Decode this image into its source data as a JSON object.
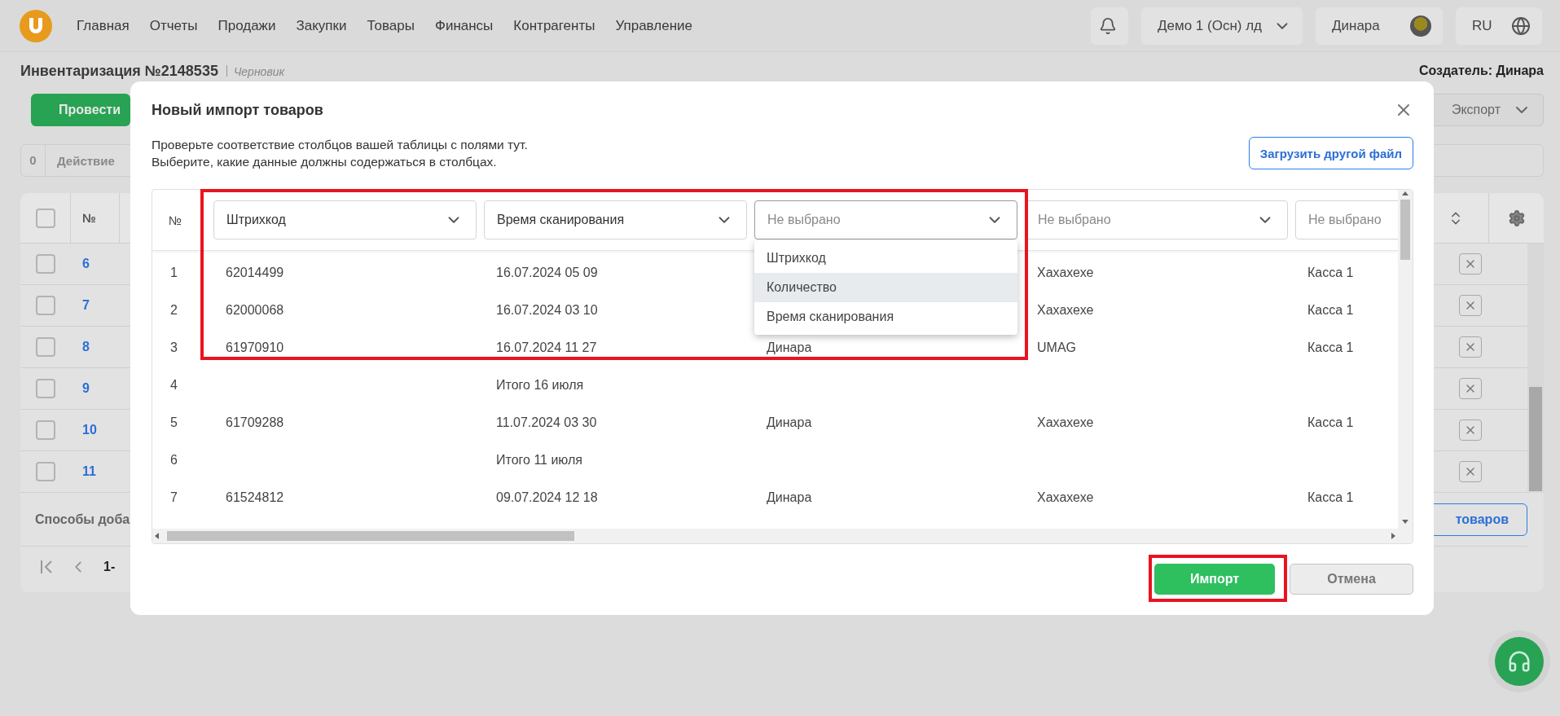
{
  "top_nav": {
    "menu": [
      "Главная",
      "Отчеты",
      "Продажи",
      "Закупки",
      "Товары",
      "Финансы",
      "Контрагенты",
      "Управление"
    ],
    "company": "Демо 1 (Осн) лд",
    "user": "Динара",
    "language": "RU"
  },
  "page": {
    "title": "Инвентаризация №2148535",
    "status": "Черновик",
    "creator": "Создатель: Динара",
    "primary_button": "Провести",
    "export_button": "Экспорт",
    "action_bar": {
      "count": "0",
      "label": "Действие"
    },
    "table": {
      "number_header": "№",
      "all_checked": false,
      "rows": [
        {
          "number": "6",
          "checked": false
        },
        {
          "number": "7",
          "checked": false
        },
        {
          "number": "8",
          "checked": false
        },
        {
          "number": "9",
          "checked": false
        },
        {
          "number": "10",
          "checked": false
        },
        {
          "number": "11",
          "checked": false
        }
      ]
    },
    "add_methods": "Способы доба",
    "add_button": "товаров",
    "pagination": "1-"
  },
  "modal": {
    "title": "Новый импорт товаров",
    "description": [
      "Проверьте соответствие столбцов вашей таблицы с полями тут.",
      "Выберите, какие данные должны содержаться в столбцах."
    ],
    "upload_button": "Загрузить другой файл",
    "number_header": "№",
    "mappings": [
      {
        "value": "Штрихкод",
        "open": false
      },
      {
        "value": "Время сканирования",
        "open": false
      },
      {
        "placeholder": "Не выбрано",
        "open": true,
        "options": [
          {
            "label": "Штрихкод",
            "highlighted": false
          },
          {
            "label": "Количество",
            "highlighted": true
          },
          {
            "label": "Время сканирования",
            "highlighted": false
          }
        ]
      },
      {
        "placeholder": "Не выбрано",
        "open": false
      },
      {
        "placeholder": "Не выбрано",
        "open": false
      }
    ],
    "rows": [
      {
        "number": "1",
        "column_1": "62014499",
        "column_2": "16.07.2024 05 09",
        "column_4": "Хахахехе",
        "column_5": "Касса 1"
      },
      {
        "number": "2",
        "column_1": "62000068",
        "column_2": "16.07.2024 03 10",
        "column_4": "Хахахехе",
        "column_5": "Касса 1"
      },
      {
        "number": "3",
        "column_1": "61970910",
        "column_2": "16.07.2024 11 27",
        "column_3": "Динара",
        "column_4": "UMAG",
        "column_5": "Касса 1"
      },
      {
        "number": "4",
        "column_2": "Итого 16 июля"
      },
      {
        "number": "5",
        "column_1": "61709288",
        "column_2": "11.07.2024 03 30",
        "column_3": "Динара",
        "column_4": "Хахахехе",
        "column_5": "Касса 1"
      },
      {
        "number": "6",
        "column_2": "Итого 11 июля"
      },
      {
        "number": "7",
        "column_1": "61524812",
        "column_2": "09.07.2024 12 18",
        "column_3": "Динара",
        "column_4": "Хахахехе",
        "column_5": "Касса 1"
      }
    ],
    "import_button": "Импорт",
    "cancel_button": "Отмена",
    "mapping_highlighted": true,
    "import_highlighted": true
  }
}
